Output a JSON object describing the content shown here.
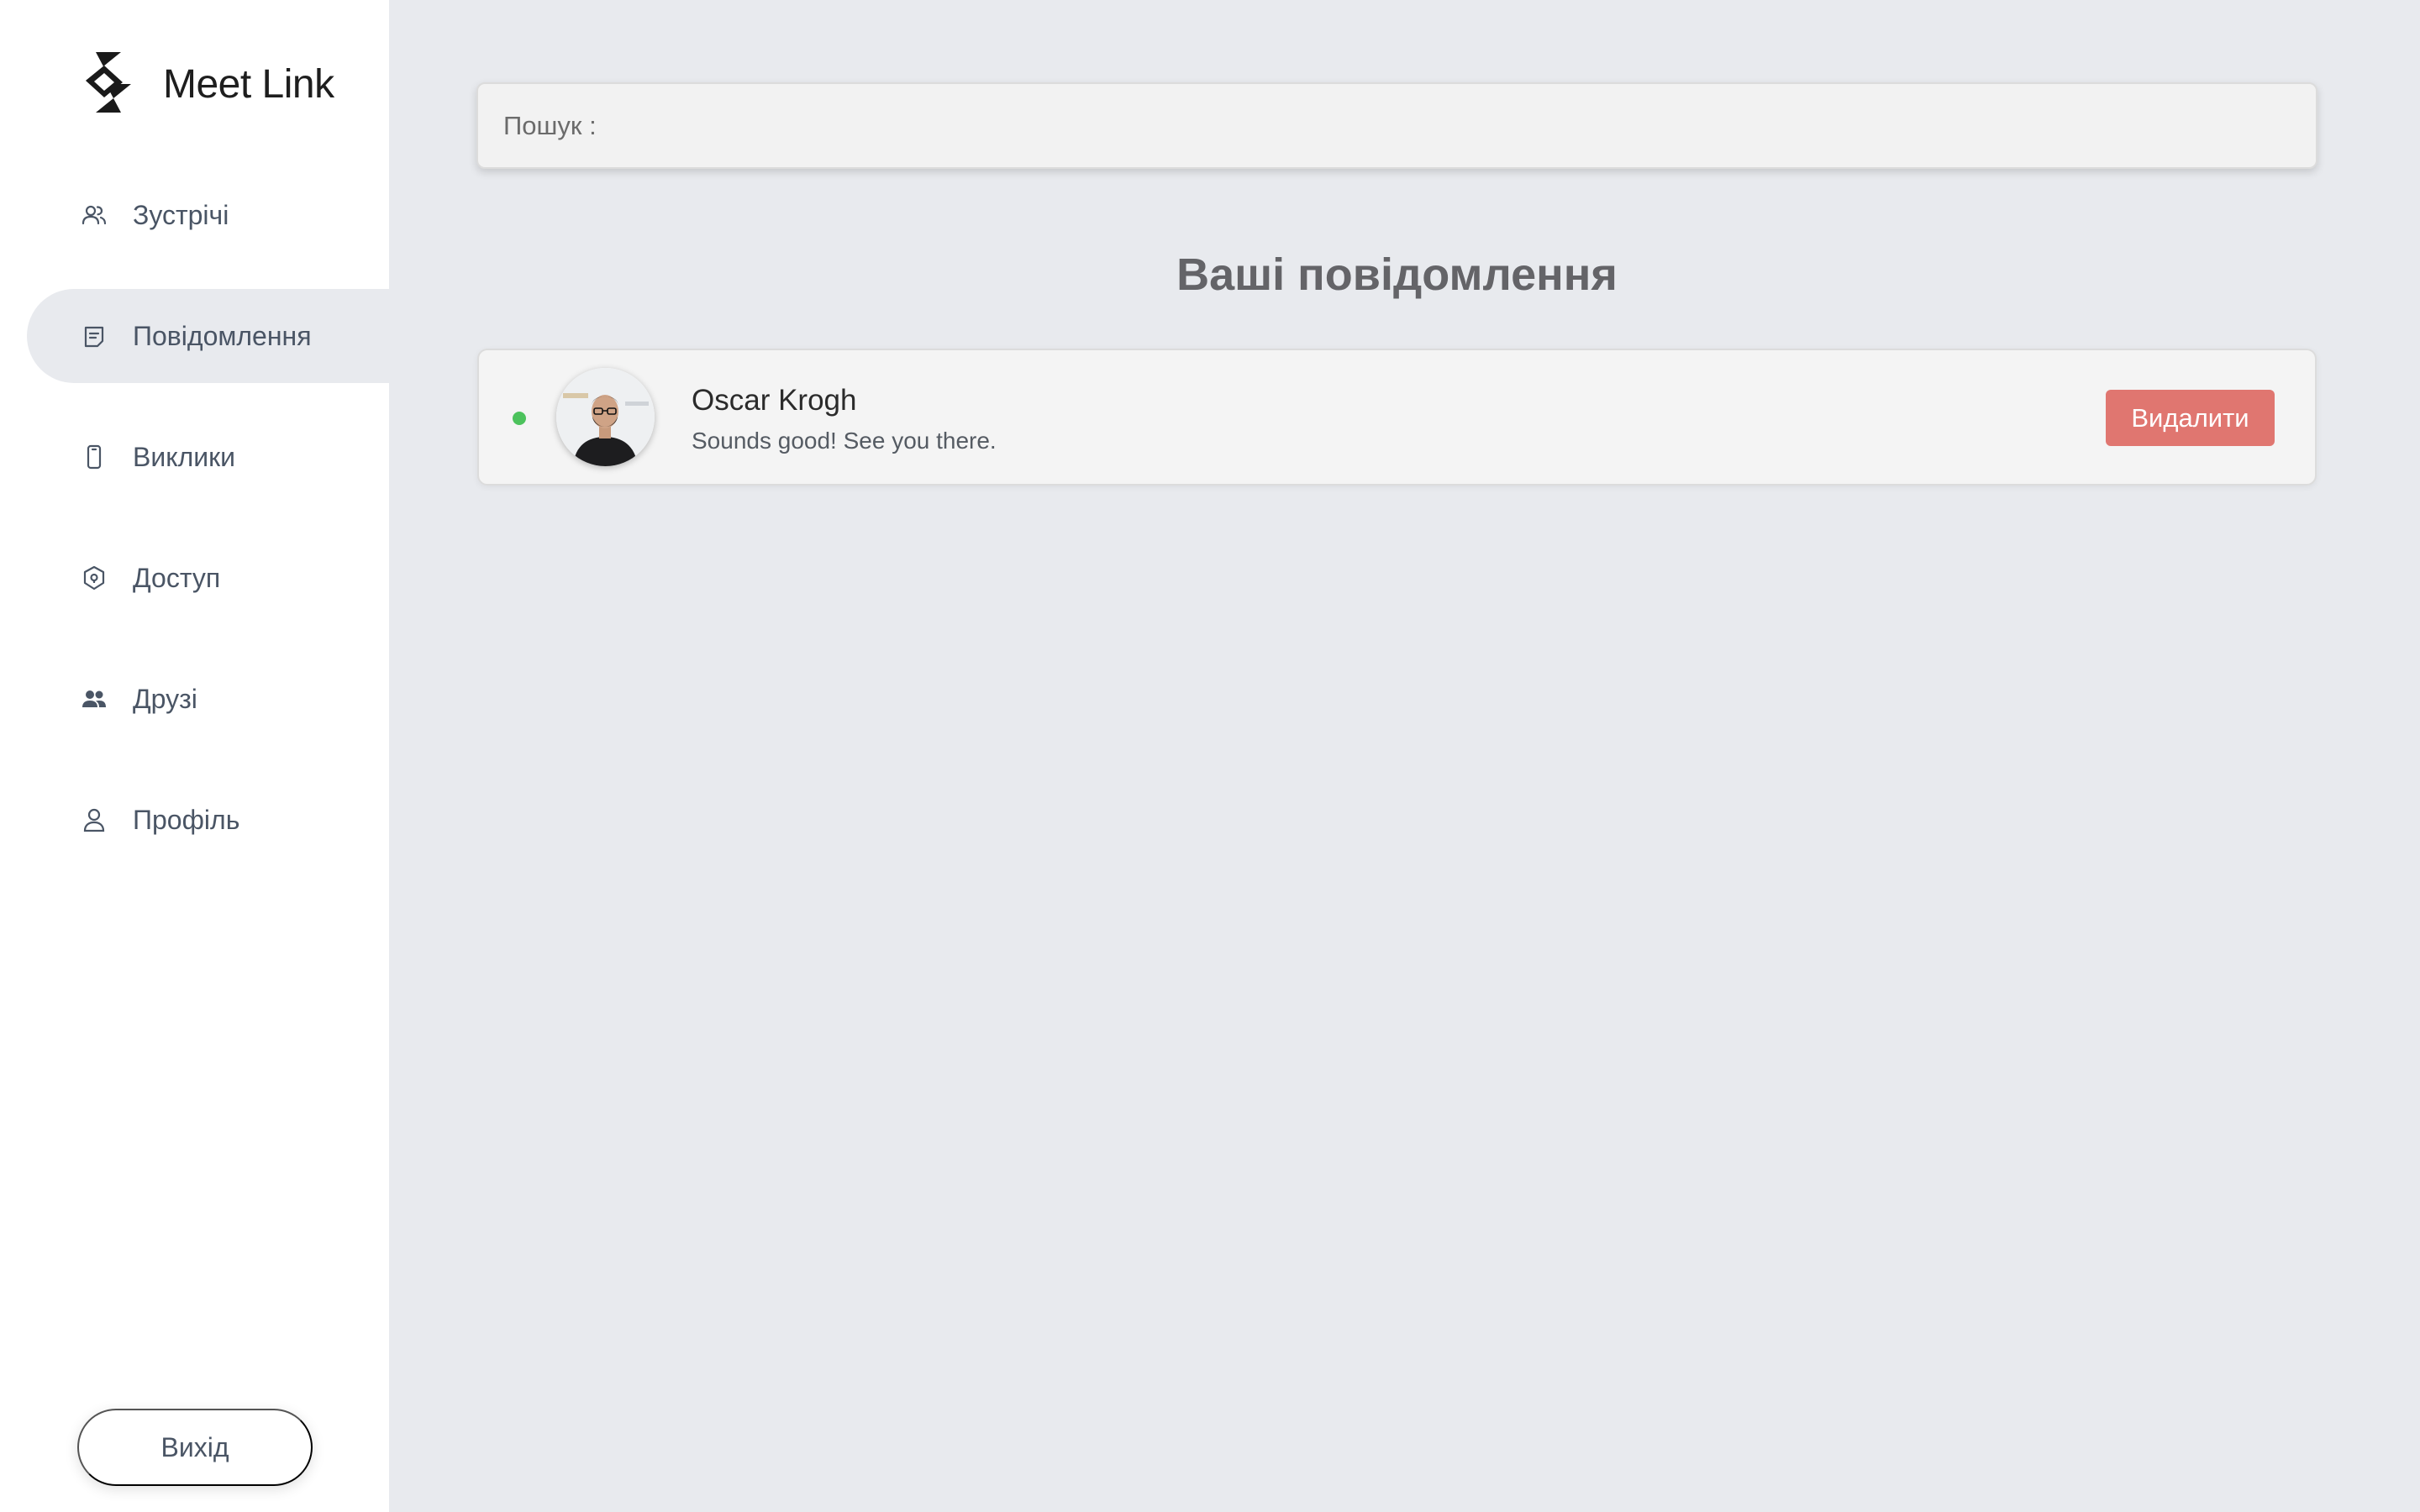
{
  "app": {
    "name": "Meet Link",
    "logo_icon": "meet-link-logo"
  },
  "sidebar": {
    "items": [
      {
        "label": "Зустрічі",
        "icon": "users-icon"
      },
      {
        "label": "Повідомлення",
        "icon": "message-icon",
        "active": true
      },
      {
        "label": "Виклики",
        "icon": "phone-icon"
      },
      {
        "label": "Доступ",
        "icon": "shield-icon"
      },
      {
        "label": "Друзі",
        "icon": "friends-icon"
      },
      {
        "label": "Профіль",
        "icon": "user-icon"
      }
    ],
    "logout_label": "Вихід"
  },
  "search": {
    "label": "Пошук :",
    "value": "",
    "placeholder": ""
  },
  "main": {
    "title": "Ваші повідомлення",
    "messages": [
      {
        "name": "Oscar Krogh",
        "text": "Sounds good! See you there.",
        "status": "online",
        "delete_label": "Видалити"
      }
    ]
  },
  "colors": {
    "background": "#e8eaee",
    "sidebar": "#ffffff",
    "delete_button": "#e07670",
    "online": "#4cc25c",
    "title": "#646468"
  }
}
